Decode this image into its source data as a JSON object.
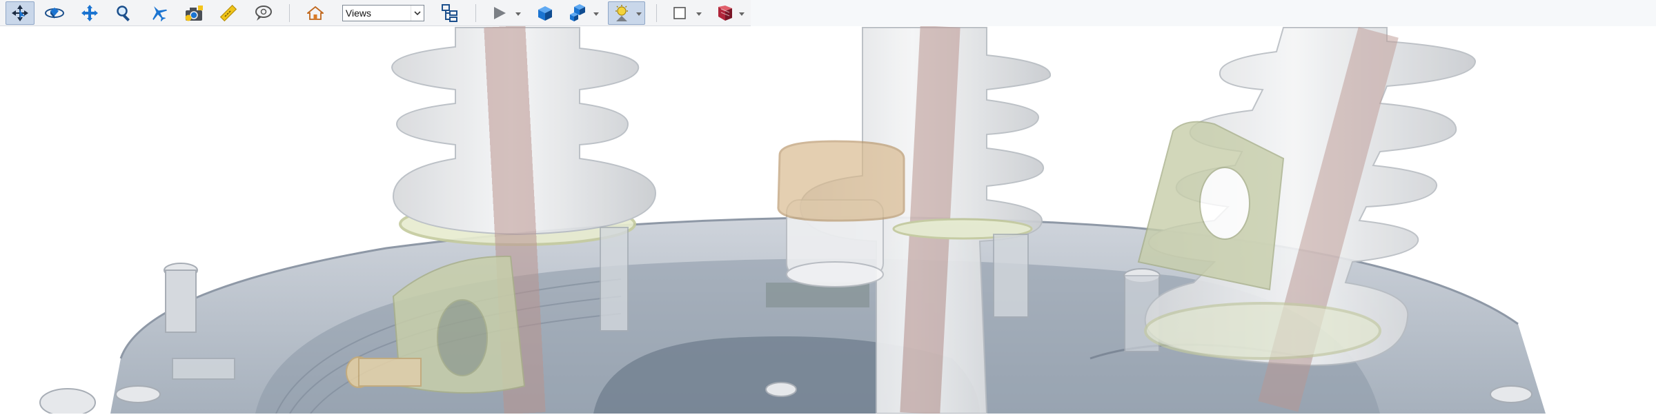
{
  "toolbar": {
    "tools": [
      {
        "name": "select-tool",
        "icon": "select-arrow-icon"
      },
      {
        "name": "orbit-tool",
        "icon": "orbit-icon"
      },
      {
        "name": "pan-tool",
        "icon": "pan-icon"
      },
      {
        "name": "zoom-tool",
        "icon": "zoom-icon"
      },
      {
        "name": "fly-tool",
        "icon": "airplane-icon"
      },
      {
        "name": "snapshot-tool",
        "icon": "camera-icon"
      },
      {
        "name": "measure-tool",
        "icon": "ruler-icon"
      },
      {
        "name": "markup-tool",
        "icon": "speech-bubble-icon"
      }
    ],
    "home_icon": "home-icon",
    "views_select": {
      "value": "Views"
    },
    "view_tree_icon": "view-tree-icon",
    "play_icon": "play-icon",
    "cube_icon": "cube-icon",
    "explode_icon": "explode-icon",
    "lighting_icon": "lighting-icon",
    "section_icon": "section-box-icon",
    "render_icon": "render-mode-icon"
  },
  "colors": {
    "toolbar_bg": "#f3f4f6",
    "accent_blue": "#1b74d1",
    "tank_gray": "#b8c0cb",
    "insulator_white": "#e8eaec",
    "conductor_rod": "#b9958f",
    "bracket_green": "#c7ceaa",
    "fuse_tan": "#d8b98c"
  }
}
